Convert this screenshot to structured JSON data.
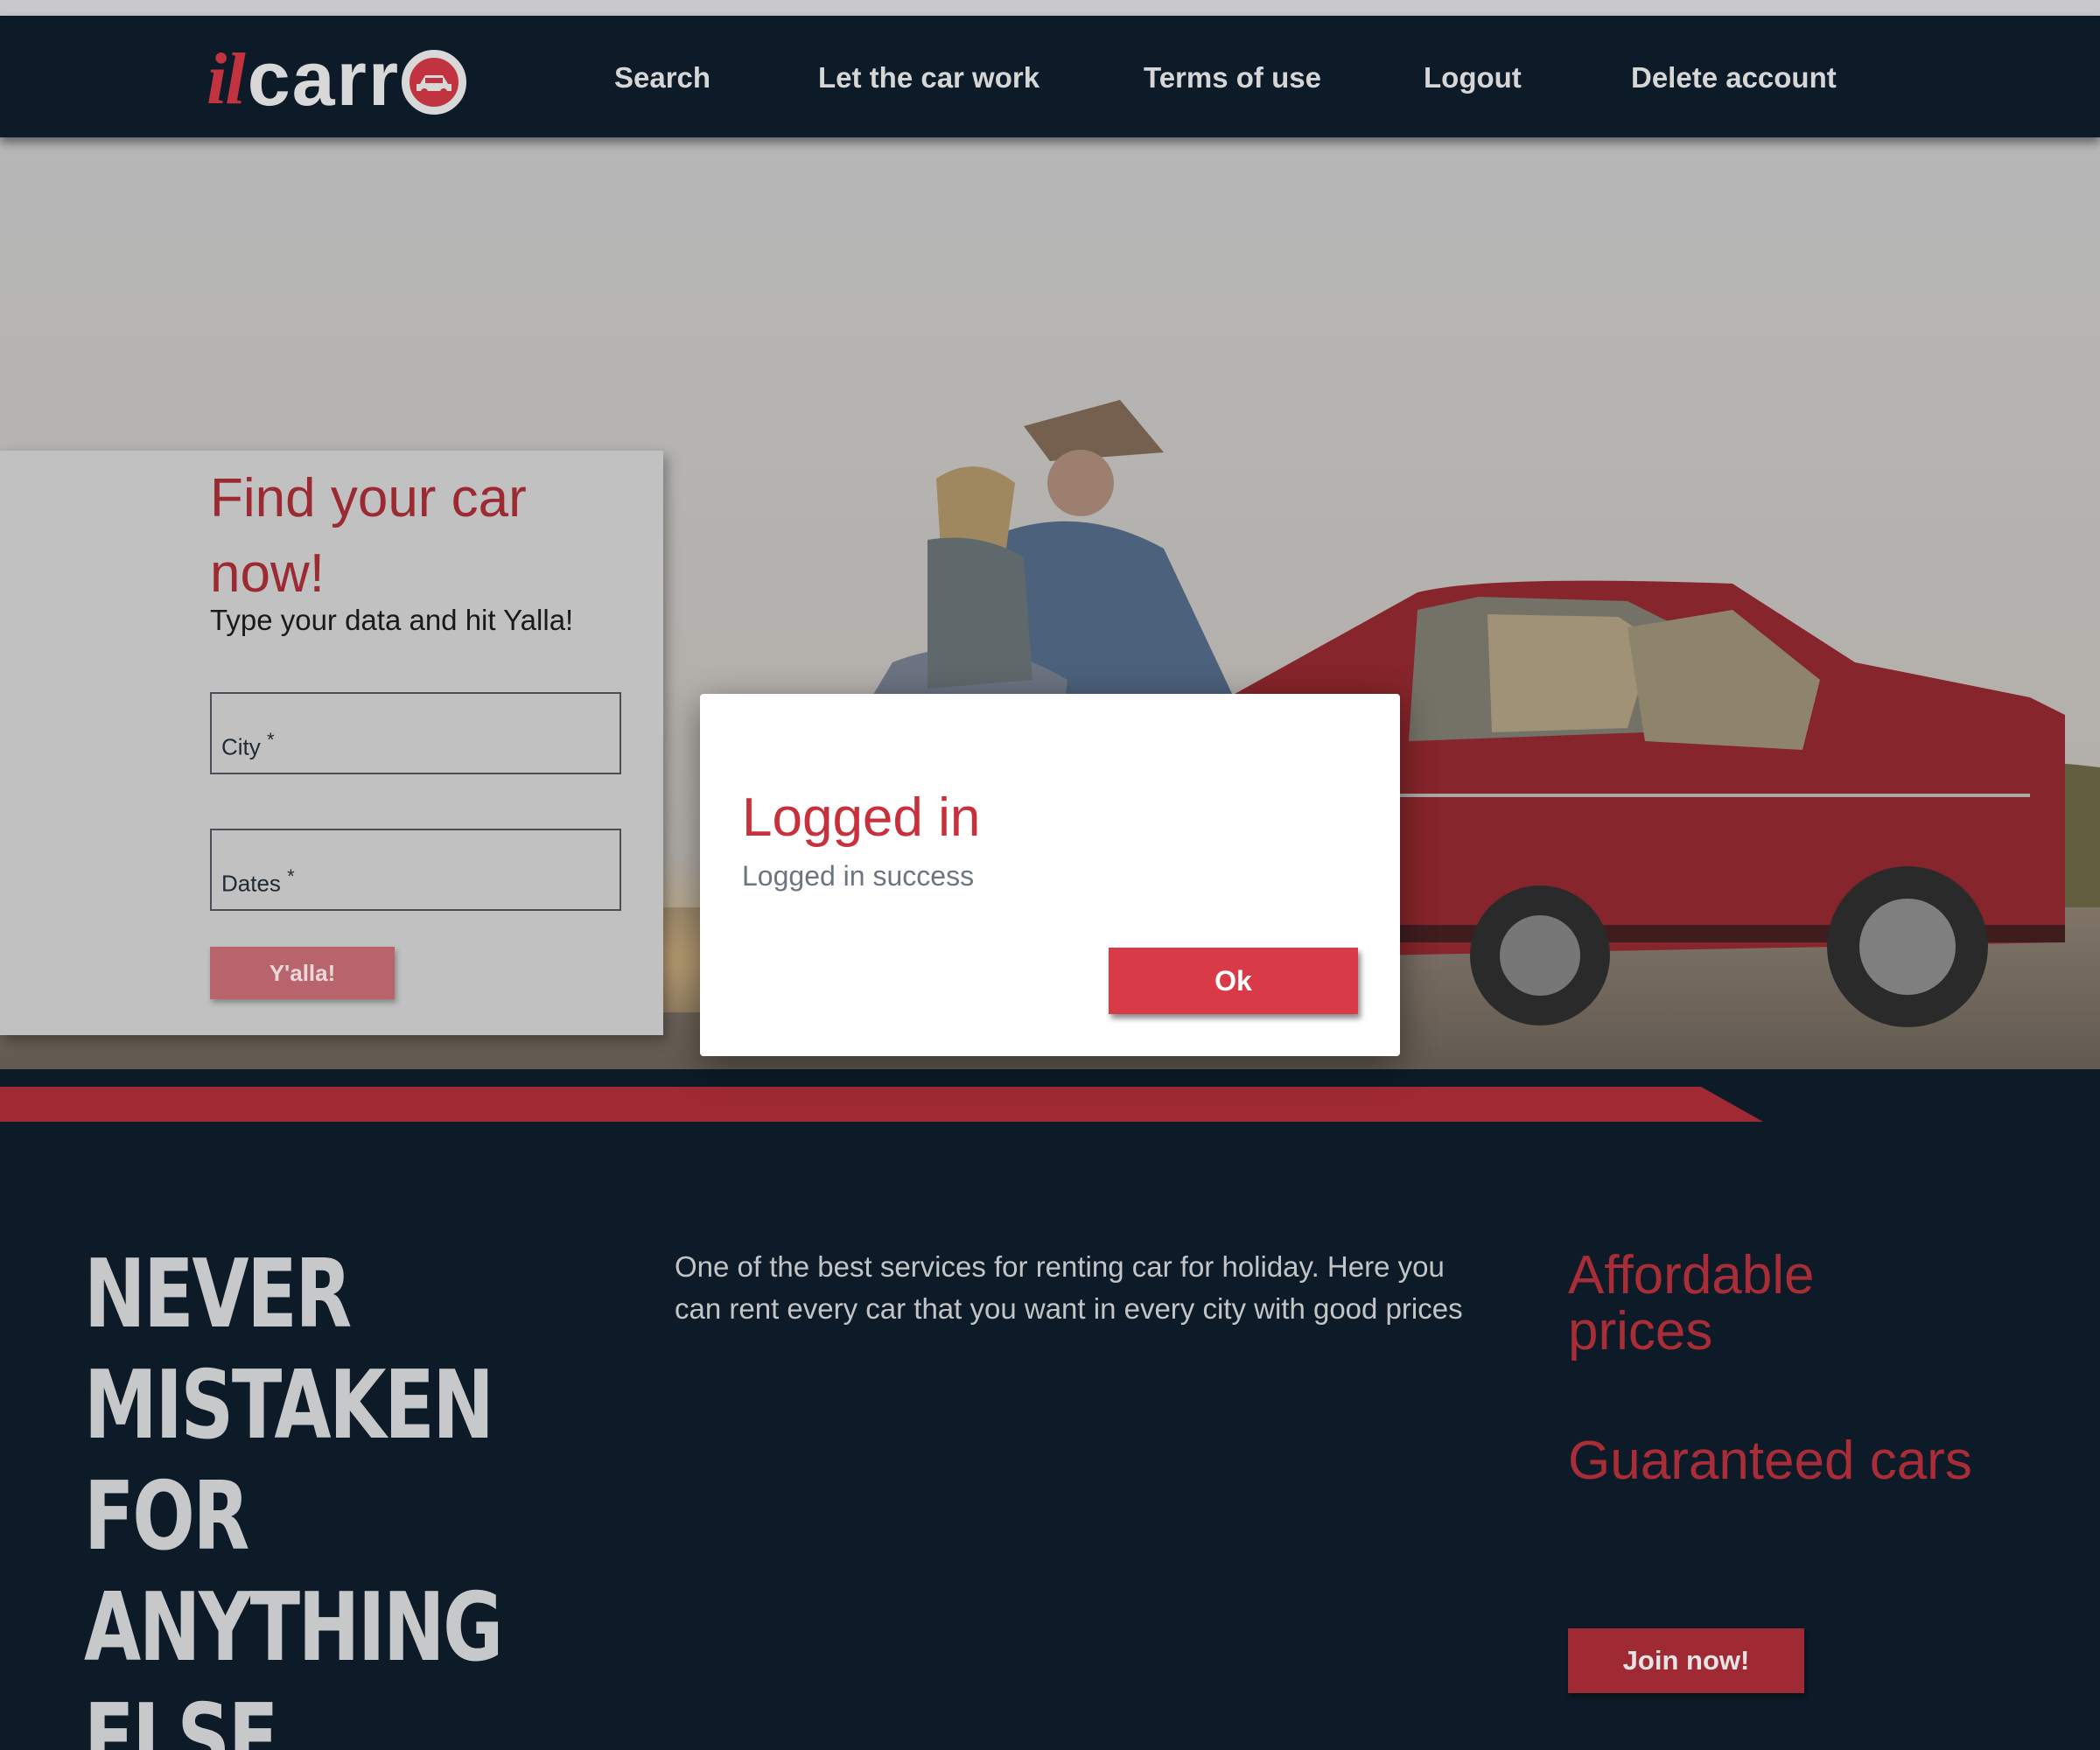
{
  "brand": {
    "logo_prefix": "il",
    "logo_text": "carr",
    "logo_icon": "car-in-circle-icon",
    "primary_color": "#c8303c",
    "dark_color": "#0d1b28"
  },
  "nav": {
    "items": [
      {
        "label": "Search"
      },
      {
        "label": "Let the car work"
      },
      {
        "label": "Terms of use"
      },
      {
        "label": "Logout"
      },
      {
        "label": "Delete account"
      }
    ]
  },
  "search_card": {
    "title": "Find your car now!",
    "subtitle": "Type your data and hit Yalla!",
    "city_label": "City",
    "dates_label": "Dates",
    "required_mark": "*",
    "submit_label": "Y'alla!"
  },
  "about": {
    "slogan_lines": [
      "NEVER",
      "MISTAKEN FOR",
      "ANYTHING",
      "ELSE"
    ],
    "description": "One of the best services for renting car for holiday. Here you can rent every car that you want in every city with good prices",
    "features": [
      "Affordable prices",
      "Guaranteed cars"
    ],
    "join_label": "Join now!"
  },
  "dialog": {
    "title": "Logged in",
    "message": "Logged in success",
    "ok_label": "Ok"
  }
}
